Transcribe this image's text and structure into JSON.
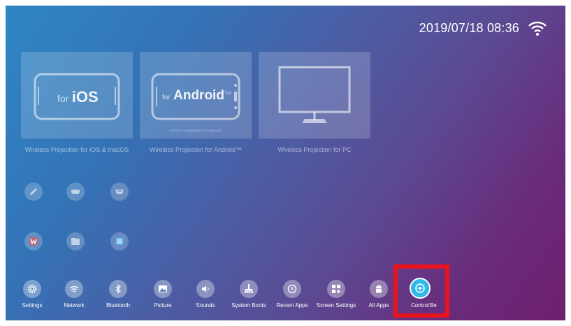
{
  "status": {
    "datetime": "2019/07/18 08:36",
    "wifi_icon": "wifi-icon"
  },
  "tiles": [
    {
      "label": "Wireless Projection for iOS & macOS",
      "for_text": "for",
      "brand": "iOS"
    },
    {
      "label": "Wireless Projection for Android™",
      "for_text": "for",
      "brand": "Android",
      "tm": "TM",
      "trademark": "Android is a trademark of Google LLC"
    },
    {
      "label": "Wireless Projection for PC"
    }
  ],
  "apps": [
    {
      "icon": "pencil-icon"
    },
    {
      "icon": "hdmi-icon"
    },
    {
      "icon": "vga-icon"
    },
    {
      "icon": "wps-office-icon"
    },
    {
      "icon": "file-manager-icon"
    },
    {
      "icon": "gallery-icon"
    }
  ],
  "dock": [
    {
      "label": "Settings",
      "icon": "gear-icon"
    },
    {
      "label": "Network",
      "icon": "wifi-icon"
    },
    {
      "label": "Bluetooth",
      "icon": "bluetooth-icon"
    },
    {
      "label": "Picture",
      "icon": "picture-icon"
    },
    {
      "label": "Sounds",
      "icon": "speaker-icon"
    },
    {
      "label": "System Boots",
      "icon": "broom-icon"
    },
    {
      "label": "Recent Apps",
      "icon": "history-icon"
    },
    {
      "label": "Screen Settings",
      "icon": "screen-settings-icon"
    },
    {
      "label": "All Apps",
      "icon": "android-icon"
    },
    {
      "label": "Control",
      "icon": "dpad-icon"
    },
    {
      "label": "Be",
      "icon": ""
    }
  ],
  "colors": {
    "highlight": "#e8141c",
    "control_accent": "#2fb8e8"
  }
}
